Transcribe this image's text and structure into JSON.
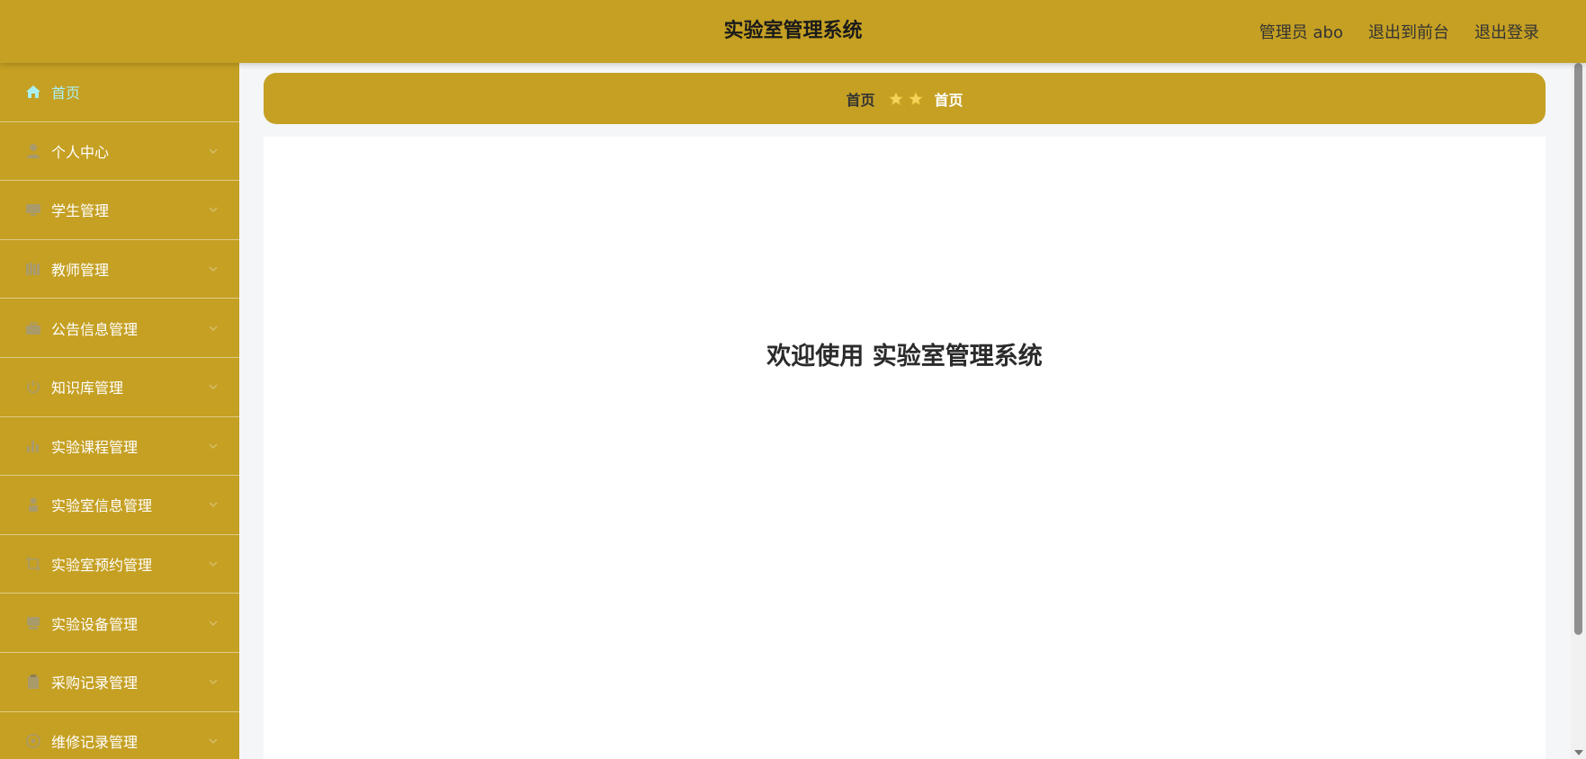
{
  "header": {
    "title": "实验室管理系统",
    "admin_label": "管理员 abo",
    "to_frontend": "退出到前台",
    "logout": "退出登录"
  },
  "sidebar": {
    "items": [
      {
        "label": "首页",
        "icon": "home-icon",
        "active": true
      },
      {
        "label": "个人中心",
        "icon": "user-icon"
      },
      {
        "label": "学生管理",
        "icon": "monitor-icon"
      },
      {
        "label": "教师管理",
        "icon": "books-icon"
      },
      {
        "label": "公告信息管理",
        "icon": "briefcase-icon"
      },
      {
        "label": "知识库管理",
        "icon": "power-icon"
      },
      {
        "label": "实验课程管理",
        "icon": "bar-chart-icon"
      },
      {
        "label": "实验室信息管理",
        "icon": "person-icon"
      },
      {
        "label": "实验室预约管理",
        "icon": "crop-icon"
      },
      {
        "label": "实验设备管理",
        "icon": "device-icon"
      },
      {
        "label": "采购记录管理",
        "icon": "clipboard-icon"
      },
      {
        "label": "维修记录管理",
        "icon": "help-circle-icon"
      }
    ]
  },
  "breadcrumb": {
    "home": "首页",
    "current": "首页"
  },
  "main": {
    "welcome": "欢迎使用 实验室管理系统"
  },
  "colors": {
    "primary": "#c5a023",
    "active_text": "#a9f0f0",
    "star": "#f5d35a"
  }
}
